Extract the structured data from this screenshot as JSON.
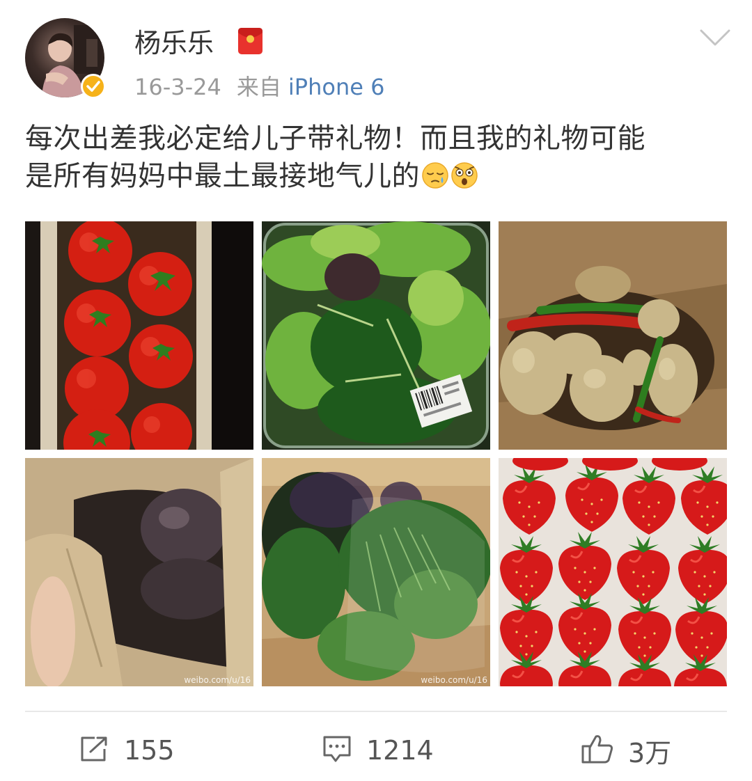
{
  "post": {
    "user": {
      "name": "杨乐乐",
      "verified": true
    },
    "time": "16-3-24",
    "source_label": "来自",
    "device": "iPhone 6",
    "text_line1": "每次出差我必定给儿子带礼物！而且我的礼物可能",
    "text_line2": "是所有妈妈中最土最接地气儿的",
    "emojis": [
      "sleepy-face-icon",
      "astonished-face-icon"
    ],
    "images": [
      {
        "subject": "tomatoes",
        "watermark": ""
      },
      {
        "subject": "salad-greens",
        "watermark": ""
      },
      {
        "subject": "potatoes-and-peppers",
        "watermark": ""
      },
      {
        "subject": "beets-in-paper-bag",
        "watermark": "weibo.com/u/16"
      },
      {
        "subject": "herbs-in-box",
        "watermark": "weibo.com/u/16"
      },
      {
        "subject": "strawberries",
        "watermark": ""
      }
    ]
  },
  "actions": {
    "repost": {
      "icon": "share-icon",
      "count": "155"
    },
    "comment": {
      "icon": "comment-icon",
      "count": "1214"
    },
    "like": {
      "icon": "thumbs-up-icon",
      "count": "3万"
    }
  },
  "colors": {
    "link": "#4f7fb7",
    "meta": "#999999",
    "badge": "#f6b21a",
    "redpacket": "#e8322d"
  }
}
